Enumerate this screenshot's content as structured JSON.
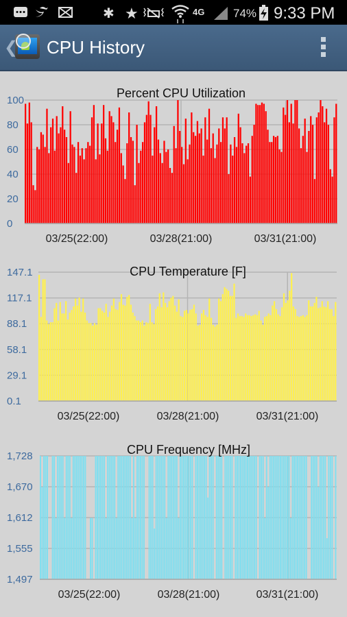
{
  "statusbar": {
    "left_icons": [
      "messages-icon",
      "twitter-icon",
      "email-icon"
    ],
    "right_icons": [
      "bluetooth-icon",
      "star-icon",
      "vibrate-icon",
      "wifi-icon",
      "4g-lte-icon",
      "signal-icon"
    ],
    "battery_percent": "74%",
    "battery_icon": "battery-charging-icon",
    "time": "9:33 PM"
  },
  "appbar": {
    "back_icon": "chevron-left-icon",
    "app_icon": "cpu-monitor-app-icon",
    "title": "CPU History",
    "menu_icon": "overflow-menu-icon"
  },
  "chart_data": [
    {
      "type": "bar",
      "title": "Percent CPU Utilization",
      "xlabel": "",
      "ylabel": "",
      "color": "#ff0000",
      "ylim": [
        0,
        100
      ],
      "yticks": [
        "0",
        "20",
        "40",
        "60",
        "80",
        "100"
      ],
      "xticks": [
        "03/25(22:00)",
        "03/28(21:00)",
        "03/31(21:00)"
      ],
      "grid": true,
      "values": [
        97,
        81,
        98,
        82,
        31,
        27,
        62,
        60,
        74,
        72,
        62,
        93,
        57,
        78,
        85,
        59,
        87,
        73,
        78,
        95,
        76,
        70,
        49,
        91,
        64,
        62,
        41,
        66,
        55,
        61,
        52,
        61,
        66,
        63,
        86,
        96,
        52,
        81,
        56,
        81,
        96,
        69,
        59,
        91,
        87,
        82,
        66,
        76,
        94,
        57,
        47,
        36,
        65,
        90,
        70,
        67,
        31,
        80,
        49,
        59,
        66,
        82,
        88,
        99,
        88,
        55,
        78,
        95,
        68,
        57,
        49,
        67,
        58,
        60,
        45,
        41,
        79,
        61,
        100,
        75,
        62,
        48,
        85,
        52,
        64,
        90,
        74,
        71,
        83,
        73,
        77,
        55,
        86,
        68,
        93,
        61,
        73,
        53,
        64,
        77,
        66,
        86,
        77,
        86,
        40,
        64,
        55,
        70,
        62,
        89,
        78,
        65,
        57,
        63,
        65,
        38,
        71,
        80,
        97,
        96,
        96,
        98,
        97,
        91,
        76,
        66,
        66,
        71,
        70,
        71,
        60,
        58,
        94,
        88,
        100,
        82,
        97,
        81,
        100,
        100,
        77,
        61,
        71,
        85,
        58,
        75,
        87,
        80,
        36,
        86,
        90,
        100,
        95,
        82,
        93,
        80,
        44,
        38,
        86,
        97
      ]
    },
    {
      "type": "bar",
      "title": "CPU Temperature [F]",
      "xlabel": "",
      "ylabel": "",
      "color": "#fff04e",
      "ylim": [
        0.1,
        147.1
      ],
      "yticks": [
        "0.1",
        "29.1",
        "58.1",
        "88.1",
        "117.1",
        "147.1"
      ],
      "xticks": [
        "03/25(22:00)",
        "03/28(21:00)",
        "03/31(21:00)"
      ],
      "grid": true,
      "values": [
        144,
        96,
        139,
        139,
        92,
        88,
        90,
        90,
        106,
        112,
        92,
        113,
        100,
        100,
        114,
        93,
        101,
        104,
        108,
        117,
        109,
        118,
        102,
        117,
        101,
        92,
        89,
        89,
        86,
        89,
        87,
        106,
        106,
        103,
        101,
        111,
        96,
        102,
        109,
        117,
        105,
        104,
        113,
        122,
        110,
        109,
        119,
        121,
        110,
        101,
        97,
        92,
        92,
        90,
        92,
        86,
        90,
        89,
        111,
        90,
        88,
        105,
        108,
        123,
        107,
        124,
        112,
        107,
        114,
        118,
        120,
        109,
        102,
        116,
        97,
        96,
        103,
        104,
        100,
        104,
        105,
        110,
        100,
        86,
        87,
        100,
        104,
        98,
        96,
        117,
        95,
        87,
        85,
        87,
        117,
        114,
        122,
        130,
        128,
        126,
        120,
        120,
        134,
        95,
        100,
        97,
        97,
        96,
        100,
        98,
        98,
        97,
        98,
        99,
        98,
        103,
        92,
        87,
        96,
        97,
        100,
        98,
        109,
        114,
        105,
        99,
        97,
        107,
        123,
        112,
        115,
        126,
        146,
        108,
        105,
        97,
        96,
        97,
        98,
        96,
        98,
        115,
        108,
        108,
        112,
        119,
        106,
        107,
        114,
        108,
        107,
        114,
        105,
        105,
        97,
        113
      ]
    },
    {
      "type": "bar",
      "title": "CPU Frequency [MHz]",
      "xlabel": "",
      "ylabel": "",
      "color": "#7fdff0",
      "ylim": [
        1497,
        1728
      ],
      "yticks": [
        "1,497",
        "1,555",
        "1,612",
        "1,670",
        "1,728"
      ],
      "xticks": [
        "03/25(22:00)",
        "03/28(21:00)",
        "03/31(21:00)"
      ],
      "grid": true,
      "values": [
        1728,
        1670,
        1728,
        1728,
        1728,
        1497,
        1497,
        1728,
        1728,
        1612,
        1728,
        1728,
        1728,
        1728,
        1612,
        1728,
        1728,
        1728,
        1612,
        1728,
        1728,
        1728,
        1728,
        1728,
        1728,
        1728,
        1728,
        1497,
        1497,
        1612,
        1612,
        1497,
        1728,
        1728,
        1728,
        1728,
        1728,
        1728,
        1612,
        1728,
        1728,
        1728,
        1728,
        1728,
        1612,
        1728,
        1728,
        1728,
        1728,
        1728,
        1728,
        1728,
        1728,
        1612,
        1728,
        1612,
        1728,
        1728,
        1728,
        1728,
        1728,
        1497,
        1497,
        1728,
        1728,
        1728,
        1592,
        1728,
        1728,
        1728,
        1728,
        1728,
        1728,
        1612,
        1728,
        1728,
        1728,
        1728,
        1728,
        1728,
        1612,
        1728,
        1728,
        1728,
        1728,
        1728,
        1728,
        1728,
        1728,
        1497,
        1728,
        1728,
        1728,
        1728,
        1728,
        1728,
        1728,
        1650,
        1728,
        1728,
        1728,
        1497,
        1728,
        1728,
        1728,
        1728,
        1497,
        1728,
        1728,
        1728,
        1728,
        1728,
        1497,
        1728,
        1728,
        1728,
        1728,
        1728,
        1728,
        1728,
        1728,
        1728,
        1728,
        1728,
        1728,
        1728,
        1497,
        1728,
        1728,
        1728,
        1612,
        1728,
        1670,
        1728,
        1728,
        1728,
        1728,
        1728,
        1728,
        1728,
        1728,
        1728,
        1728,
        1728,
        1728,
        1612,
        1728,
        1728,
        1728,
        1728,
        1728,
        1728,
        1728,
        1728,
        1728,
        1497,
        1497,
        1728,
        1728,
        1728,
        1728,
        1670,
        1728,
        1728,
        1728,
        1728,
        1574,
        1728,
        1728,
        1728,
        1497,
        1728
      ]
    }
  ]
}
